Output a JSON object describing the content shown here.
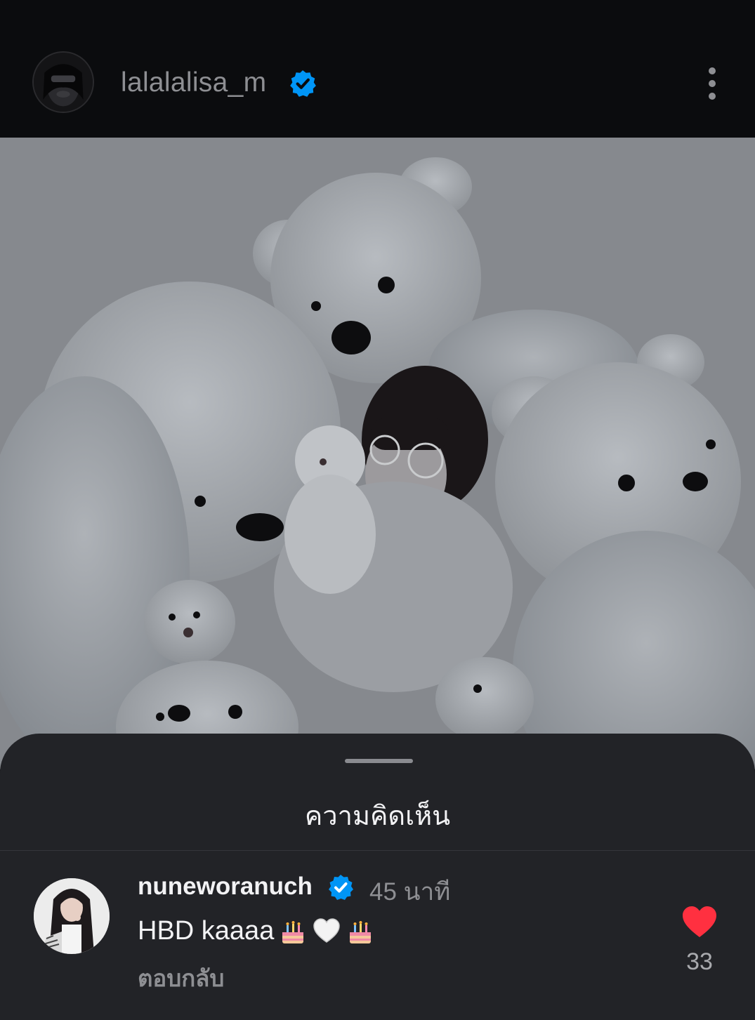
{
  "header": {
    "username": "lalalalisa_m",
    "verified": true,
    "more_icon": "more-vertical-icon"
  },
  "post": {
    "image_alt": "photo-of-person-with-white-teddy-bears"
  },
  "comments_sheet": {
    "title": "ความคิดเห็น",
    "comments": [
      {
        "username": "nuneworanuch",
        "verified": true,
        "time": "45 นาที",
        "text": "HBD kaaaa",
        "emojis": [
          "birthday-cake",
          "white-heart",
          "birthday-cake"
        ],
        "reply_label": "ตอบกลับ",
        "likes": "33",
        "liked": true
      }
    ]
  },
  "colors": {
    "background": "#0b0c0e",
    "sheet": "#222327",
    "verified_blue": "#0095f6",
    "like_red": "#ff3040",
    "muted_text": "#8e8f93"
  }
}
